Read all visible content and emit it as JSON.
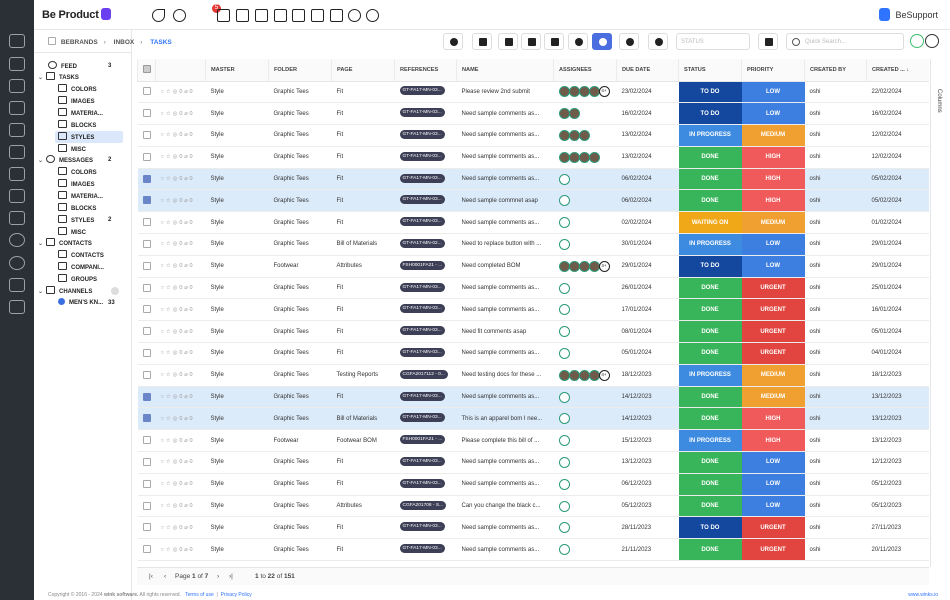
{
  "app": {
    "brand": "Be Product",
    "support": "BeSupport",
    "bell_count": "5"
  },
  "breadcrumb": [
    "BEBRANDS",
    "INBOX",
    "TASKS"
  ],
  "sidebar": {
    "feed": {
      "label": "FEED",
      "count": "3"
    },
    "tasks": {
      "label": "TASKS",
      "children": [
        "COLORS",
        "IMAGES",
        "MATERIA...",
        "BLOCKS",
        "STYLES",
        "MISC"
      ]
    },
    "messages": {
      "label": "MESSAGES",
      "count": "2",
      "children": [
        "COLORS",
        "IMAGES",
        "MATERIA...",
        "BLOCKS",
        "STYLES",
        "MISC"
      ],
      "styles_count": "2"
    },
    "contacts": {
      "label": "CONTACTS",
      "children": [
        "CONTACTS",
        "COMPANI...",
        "GROUPS"
      ]
    },
    "channels": {
      "label": "CHANNELS",
      "items": [
        {
          "label": "MEN'S KN...",
          "count": "33"
        }
      ]
    }
  },
  "toolbar": {
    "status_placeholder": "STATUS",
    "search_placeholder": "Quick Search..."
  },
  "columns": [
    "",
    "",
    "MASTER",
    "FOLDER",
    "PAGE",
    "REFERENCES",
    "NAME",
    "ASSIGNEES",
    "DUE DATE",
    "STATUS",
    "PRIORITY",
    "CREATED BY",
    "CREATED ..."
  ],
  "colors": {
    "todo": "#14479e",
    "done": "#38b55b",
    "inprogress": "#3c8be0",
    "waiting": "#f0a818",
    "low": "#3d7fe0",
    "medium": "#f0a030",
    "high": "#f05a5a",
    "urgent": "#e2453f"
  },
  "rows": [
    {
      "sel": false,
      "master": "Style",
      "folder": "Graphic Tees",
      "page": "Fit",
      "ref": "GT-FA17-MN-03...",
      "name": "Please review 2nd submit",
      "av": "4+",
      "due": "23/02/2024",
      "status": "TO DO",
      "priority": "LOW",
      "by": "oshi",
      "created": "22/02/2024"
    },
    {
      "sel": false,
      "master": "Style",
      "folder": "Graphic Tees",
      "page": "Fit",
      "ref": "GT-FA17-MN-03...",
      "name": "Need sample comments as...",
      "av": "2",
      "due": "16/02/2024",
      "status": "TO DO",
      "priority": "LOW",
      "by": "oshi",
      "created": "16/02/2024"
    },
    {
      "sel": false,
      "master": "Style",
      "folder": "Graphic Tees",
      "page": "Fit",
      "ref": "GT-FA17-MN-03...",
      "name": "Need sample comments as...",
      "av": "3",
      "due": "13/02/2024",
      "status": "IN PROGRESS",
      "priority": "MEDIUM",
      "by": "oshi",
      "created": "12/02/2024"
    },
    {
      "sel": false,
      "master": "Style",
      "folder": "Graphic Tees",
      "page": "Fit",
      "ref": "GT-FA17-MN-03...",
      "name": "Need sample comments as...",
      "av": "4",
      "due": "13/02/2024",
      "status": "DONE",
      "priority": "HIGH",
      "by": "oshi",
      "created": "12/02/2024"
    },
    {
      "sel": true,
      "master": "Style",
      "folder": "Graphic Tees",
      "page": "Fit",
      "ref": "GT-FA17-MN-03...",
      "name": "Need sample comments as...",
      "av": "1",
      "due": "06/02/2024",
      "status": "DONE",
      "priority": "HIGH",
      "by": "oshi",
      "created": "05/02/2024"
    },
    {
      "sel": true,
      "master": "Style",
      "folder": "Graphic Tees",
      "page": "Fit",
      "ref": "GT-FA17-MN-03...",
      "name": "Need sample commnet asap",
      "av": "1",
      "due": "06/02/2024",
      "status": "DONE",
      "priority": "HIGH",
      "by": "oshi",
      "created": "05/02/2024"
    },
    {
      "sel": false,
      "master": "Style",
      "folder": "Graphic Tees",
      "page": "Fit",
      "ref": "GT-FA17-MN-03...",
      "name": "Need sample comments as...",
      "av": "1",
      "due": "02/02/2024",
      "status": "WAITING ON",
      "priority": "MEDIUM",
      "by": "oshi",
      "created": "01/02/2024"
    },
    {
      "sel": false,
      "master": "Style",
      "folder": "Graphic Tees",
      "page": "Bill of Materials",
      "ref": "GT-FA17-MN-02...",
      "name": "Need to replace button with ...",
      "av": "1",
      "due": "30/01/2024",
      "status": "IN PROGRESS",
      "priority": "LOW",
      "by": "oshi",
      "created": "29/01/2024"
    },
    {
      "sel": false,
      "master": "Style",
      "folder": "Footwear",
      "page": "Attributes",
      "ref": "FSH0001FA21 - ...",
      "name": "Need completed BOM",
      "av": "4+",
      "due": "29/01/2024",
      "status": "TO DO",
      "priority": "LOW",
      "by": "oshi",
      "created": "29/01/2024"
    },
    {
      "sel": false,
      "master": "Style",
      "folder": "Graphic Tees",
      "page": "Fit",
      "ref": "GT-FA17-MN-03...",
      "name": "Need sample comments as...",
      "av": "1",
      "due": "26/01/2024",
      "status": "DONE",
      "priority": "URGENT",
      "by": "oshi",
      "created": "25/01/2024"
    },
    {
      "sel": false,
      "master": "Style",
      "folder": "Graphic Tees",
      "page": "Fit",
      "ref": "GT-FA17-MN-03...",
      "name": "Need sample comments as...",
      "av": "1",
      "due": "17/01/2024",
      "status": "DONE",
      "priority": "URGENT",
      "by": "oshi",
      "created": "16/01/2024"
    },
    {
      "sel": false,
      "master": "Style",
      "folder": "Graphic Tees",
      "page": "Fit",
      "ref": "GT-FA17-MN-03...",
      "name": "Need fit comments asap",
      "av": "1",
      "due": "08/01/2024",
      "status": "DONE",
      "priority": "URGENT",
      "by": "oshi",
      "created": "05/01/2024"
    },
    {
      "sel": false,
      "master": "Style",
      "folder": "Graphic Tees",
      "page": "Fit",
      "ref": "GT-FA17-MN-03...",
      "name": "Need sample comments as...",
      "av": "1",
      "due": "05/01/2024",
      "status": "DONE",
      "priority": "URGENT",
      "by": "oshi",
      "created": "04/01/2024"
    },
    {
      "sel": false,
      "master": "Style",
      "folder": "Graphic Tees",
      "page": "Testing Reports",
      "ref": "CGFA2017112 - 0...",
      "name": "Need testing docs for these ...",
      "av": "4+",
      "due": "18/12/2023",
      "status": "IN PROGRESS",
      "priority": "MEDIUM",
      "by": "oshi",
      "created": "18/12/2023"
    },
    {
      "sel": true,
      "master": "Style",
      "folder": "Graphic Tees",
      "page": "Fit",
      "ref": "GT-FA17-MN-03...",
      "name": "Need sample comments as...",
      "av": "1",
      "due": "14/12/2023",
      "status": "DONE",
      "priority": "MEDIUM",
      "by": "oshi",
      "created": "13/12/2023"
    },
    {
      "sel": true,
      "master": "Style",
      "folder": "Graphic Tees",
      "page": "Bill of Materials",
      "ref": "GT-FA17-MN-03...",
      "name": "This is an apparel bom I nee...",
      "av": "1",
      "due": "14/12/2023",
      "status": "DONE",
      "priority": "HIGH",
      "by": "oshi",
      "created": "13/12/2023"
    },
    {
      "sel": false,
      "master": "Style",
      "folder": "Footwear",
      "page": "Footwear BOM",
      "ref": "FSH0001FA21 - ...",
      "name": "Please complete this bill of ...",
      "av": "1",
      "due": "15/12/2023",
      "status": "IN PROGRESS",
      "priority": "HIGH",
      "by": "oshi",
      "created": "13/12/2023"
    },
    {
      "sel": false,
      "master": "Style",
      "folder": "Graphic Tees",
      "page": "Fit",
      "ref": "GT-FA17-MN-03...",
      "name": "Need sample comments as...",
      "av": "1",
      "due": "13/12/2023",
      "status": "DONE",
      "priority": "LOW",
      "by": "oshi",
      "created": "12/12/2023"
    },
    {
      "sel": false,
      "master": "Style",
      "folder": "Graphic Tees",
      "page": "Fit",
      "ref": "GT-FA17-MN-03...",
      "name": "Need sample comments as...",
      "av": "1",
      "due": "06/12/2023",
      "status": "DONE",
      "priority": "LOW",
      "by": "oshi",
      "created": "05/12/2023"
    },
    {
      "sel": false,
      "master": "Style",
      "folder": "Graphic Tees",
      "page": "Attributes",
      "ref": "CGFA201708 - S...",
      "name": "Can you change the black c...",
      "av": "1",
      "due": "05/12/2023",
      "status": "DONE",
      "priority": "LOW",
      "by": "oshi",
      "created": "05/12/2023"
    },
    {
      "sel": false,
      "master": "Style",
      "folder": "Graphic Tees",
      "page": "Fit",
      "ref": "GT-FA17-MN-03...",
      "name": "Need sample comments as...",
      "av": "1",
      "due": "28/11/2023",
      "status": "TO DO",
      "priority": "URGENT",
      "by": "oshi",
      "created": "27/11/2023"
    },
    {
      "sel": false,
      "master": "Style",
      "folder": "Graphic Tees",
      "page": "Fit",
      "ref": "GT-FA17-MN-03...",
      "name": "Need sample comments as...",
      "av": "1",
      "due": "21/11/2023",
      "status": "DONE",
      "priority": "URGENT",
      "by": "oshi",
      "created": "20/11/2023"
    }
  ],
  "pagination": {
    "page_label": "Page",
    "page": "1",
    "of": "of",
    "pages": "7",
    "range": "1",
    "to": "to",
    "shown": "22",
    "total": "151"
  },
  "side_tab": "Columns",
  "footer": {
    "copyright": "Copyright © 2016 - 2024",
    "company": "wink software.",
    "rights": "All rights reserved.",
    "terms": "Terms of use",
    "privacy": "Privacy Policy",
    "url": "www.winks.io"
  }
}
